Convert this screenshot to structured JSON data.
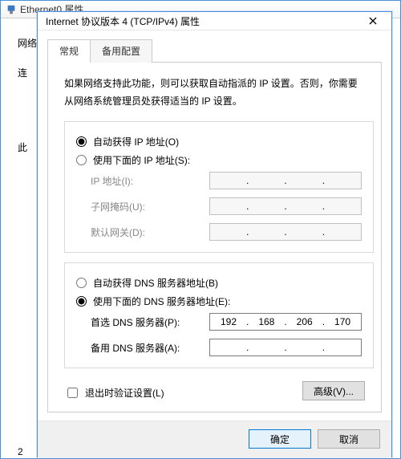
{
  "bg_window": {
    "title": "Ethernet0 属性"
  },
  "side": {
    "l1": "网络",
    "l2": "连",
    "l3": "此",
    "l4": "2"
  },
  "dialog": {
    "title": "Internet 协议版本 4 (TCP/IPv4) 属性"
  },
  "tabs": {
    "general": "常规",
    "alternate": "备用配置"
  },
  "desc": "如果网络支持此功能，则可以获取自动指派的 IP 设置。否则，你需要从网络系统管理员处获得适当的 IP 设置。",
  "ip": {
    "auto": "自动获得 IP 地址(O)",
    "manual": "使用下面的 IP 地址(S):",
    "addr_label": "IP 地址(I):",
    "mask_label": "子网掩码(U):",
    "gw_label": "默认网关(D):",
    "addr": [
      "",
      "",
      "",
      ""
    ],
    "mask": [
      "",
      "",
      "",
      ""
    ],
    "gw": [
      "",
      "",
      "",
      ""
    ]
  },
  "dns": {
    "auto": "自动获得 DNS 服务器地址(B)",
    "manual": "使用下面的 DNS 服务器地址(E):",
    "pref_label": "首选 DNS 服务器(P):",
    "alt_label": "备用 DNS 服务器(A):",
    "pref": [
      "192",
      "168",
      "206",
      "170"
    ],
    "alt": [
      "",
      "",
      "",
      ""
    ]
  },
  "validate_label": "退出时验证设置(L)",
  "advanced_label": "高级(V)...",
  "ok_label": "确定",
  "cancel_label": "取消"
}
